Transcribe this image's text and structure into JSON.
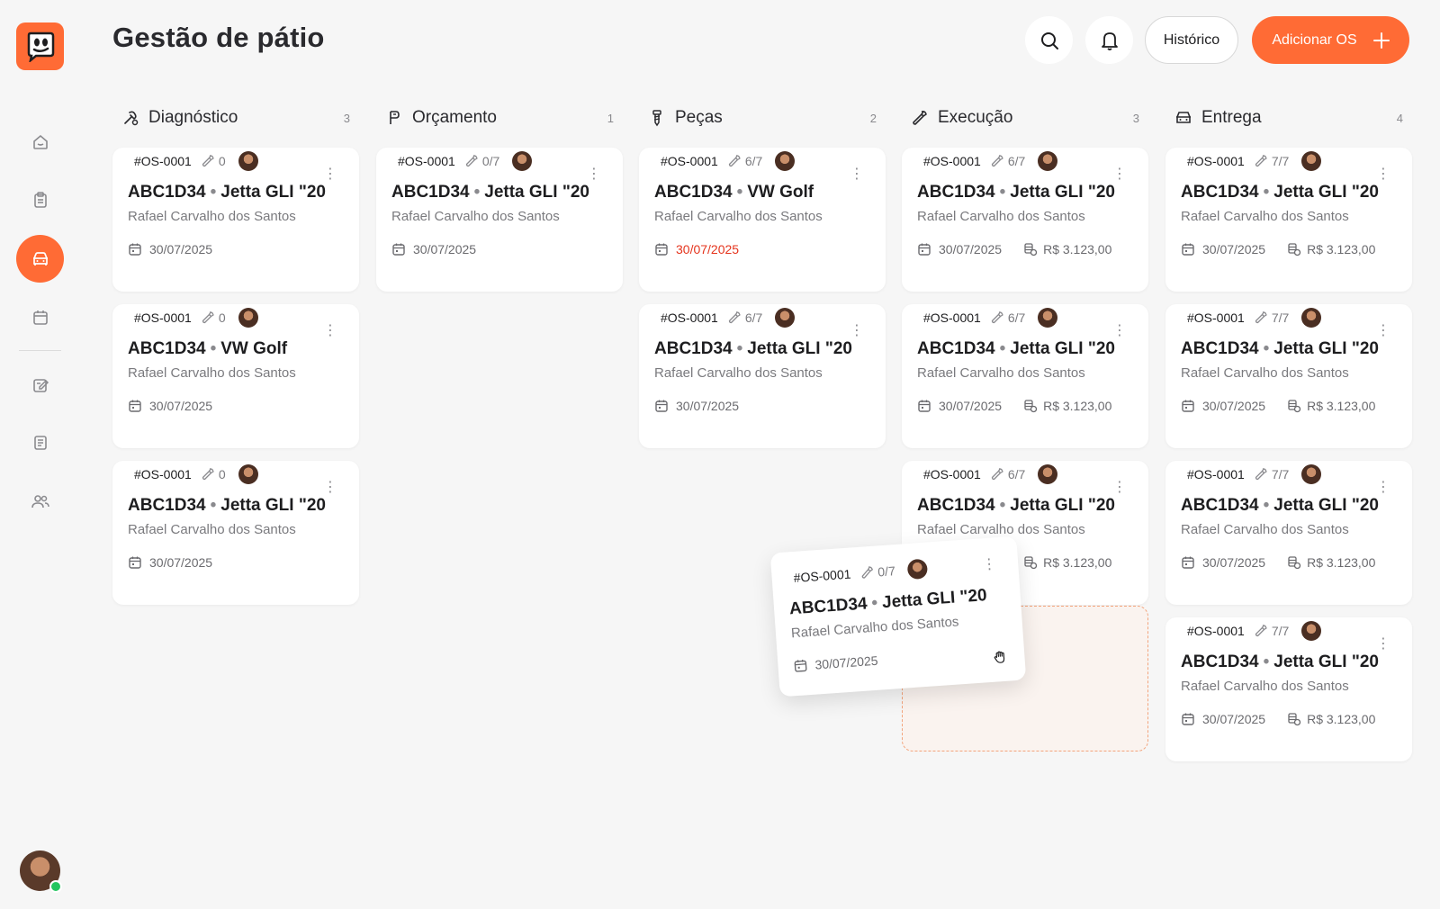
{
  "header": {
    "title": "Gestão de pátio",
    "historico_label": "Histórico",
    "add_label": "Adicionar OS"
  },
  "colors": {
    "accent": "#ff6b35",
    "overdue": "#e5341d",
    "online": "#22c55e"
  },
  "sidebar": {
    "items": [
      {
        "icon": "home-icon"
      },
      {
        "icon": "clipboard-icon"
      },
      {
        "icon": "car-icon",
        "active": true
      },
      {
        "icon": "calendar-icon"
      },
      {
        "icon": "edit-note-icon"
      },
      {
        "icon": "document-icon"
      },
      {
        "icon": "users-icon"
      }
    ]
  },
  "columns": [
    {
      "title": "Diagnóstico",
      "count": "3",
      "icon": "diagnostic-icon",
      "cards": [
        {
          "id": "#OS-0001",
          "tools": "0",
          "plate": "ABC1D34",
          "car": "Jetta GLI \"20",
          "owner": "Rafael Carvalho dos Santos",
          "date": "30/07/2025"
        },
        {
          "id": "#OS-0001",
          "tools": "0",
          "plate": "ABC1D34",
          "car": "VW Golf",
          "owner": "Rafael Carvalho dos Santos",
          "date": "30/07/2025"
        },
        {
          "id": "#OS-0001",
          "tools": "0",
          "plate": "ABC1D34",
          "car": "Jetta GLI \"20",
          "owner": "Rafael Carvalho dos Santos",
          "date": "30/07/2025"
        }
      ]
    },
    {
      "title": "Orçamento",
      "count": "1",
      "icon": "budget-icon",
      "cards": [
        {
          "id": "#OS-0001",
          "tools": "0/7",
          "plate": "ABC1D34",
          "car": "Jetta GLI \"20",
          "owner": "Rafael Carvalho dos Santos",
          "date": "30/07/2025"
        }
      ]
    },
    {
      "title": "Peças",
      "count": "2",
      "icon": "screw-icon",
      "cards": [
        {
          "id": "#OS-0001",
          "tools": "6/7",
          "plate": "ABC1D34",
          "car": "VW Golf",
          "owner": "Rafael Carvalho dos Santos",
          "date": "30/07/2025",
          "overdue": true
        },
        {
          "id": "#OS-0001",
          "tools": "6/7",
          "plate": "ABC1D34",
          "car": "Jetta GLI \"20",
          "owner": "Rafael Carvalho dos Santos",
          "date": "30/07/2025"
        }
      ]
    },
    {
      "title": "Execução",
      "count": "3",
      "icon": "wrench-icon",
      "cards": [
        {
          "id": "#OS-0001",
          "tools": "6/7",
          "plate": "ABC1D34",
          "car": "Jetta GLI \"20",
          "owner": "Rafael Carvalho dos Santos",
          "date": "30/07/2025",
          "price": "R$ 3.123,00"
        },
        {
          "id": "#OS-0001",
          "tools": "6/7",
          "plate": "ABC1D34",
          "car": "Jetta GLI \"20",
          "owner": "Rafael Carvalho dos Santos",
          "date": "30/07/2025",
          "price": "R$ 3.123,00"
        },
        {
          "id": "#OS-0001",
          "tools": "6/7",
          "plate": "ABC1D34",
          "car": "Jetta GLI \"20",
          "owner": "Rafael Carvalho dos Santos",
          "date": "30/07/2025",
          "price": "R$ 3.123,00"
        }
      ]
    },
    {
      "title": "Entrega",
      "count": "4",
      "icon": "delivery-car-icon",
      "cards": [
        {
          "id": "#OS-0001",
          "tools": "7/7",
          "plate": "ABC1D34",
          "car": "Jetta GLI \"20",
          "owner": "Rafael Carvalho dos Santos",
          "date": "30/07/2025",
          "price": "R$ 3.123,00"
        },
        {
          "id": "#OS-0001",
          "tools": "7/7",
          "plate": "ABC1D34",
          "car": "Jetta GLI \"20",
          "owner": "Rafael Carvalho dos Santos",
          "date": "30/07/2025",
          "price": "R$ 3.123,00"
        },
        {
          "id": "#OS-0001",
          "tools": "7/7",
          "plate": "ABC1D34",
          "car": "Jetta GLI \"20",
          "owner": "Rafael Carvalho dos Santos",
          "date": "30/07/2025",
          "price": "R$ 3.123,00"
        },
        {
          "id": "#OS-0001",
          "tools": "7/7",
          "plate": "ABC1D34",
          "car": "Jetta GLI \"20",
          "owner": "Rafael Carvalho dos Santos",
          "date": "30/07/2025",
          "price": "R$ 3.123,00"
        }
      ]
    }
  ],
  "dragged_card": {
    "id": "#OS-0001",
    "tools": "0/7",
    "plate": "ABC1D34",
    "car": "Jetta GLI \"20",
    "owner": "Rafael Carvalho dos Santos",
    "date": "30/07/2025"
  }
}
